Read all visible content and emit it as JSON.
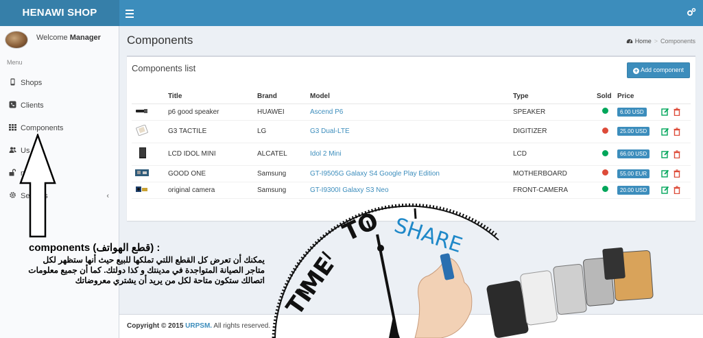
{
  "app": {
    "brand": "HENAWI SHOP"
  },
  "user": {
    "welcome": "Welcome",
    "name": "Manager"
  },
  "sidebar": {
    "menu_header": "Menu",
    "items": [
      {
        "label": "Shops",
        "icon": "mobile-icon"
      },
      {
        "label": "Clients",
        "icon": "phone-square-icon"
      },
      {
        "label": "Components",
        "icon": "grid-icon"
      },
      {
        "label": "Us",
        "icon": "users-icon"
      },
      {
        "label": "nlocking",
        "icon": "unlock-icon"
      },
      {
        "label": "Settings",
        "icon": "gear-icon"
      }
    ]
  },
  "page": {
    "title": "Components",
    "breadcrumb": {
      "home": "Home",
      "current": "Components"
    }
  },
  "box": {
    "title": "Components list",
    "add_button": "Add component",
    "columns": {
      "title": "Title",
      "brand": "Brand",
      "model": "Model",
      "type": "Type",
      "sold": "Sold",
      "price": "Price"
    },
    "rows": [
      {
        "title": "p6 good speaker",
        "brand": "HUAWEI",
        "model": "Ascend P6",
        "type": "SPEAKER",
        "sold": "green",
        "price": "6.00 USD"
      },
      {
        "title": "G3 TACTILE",
        "brand": "LG",
        "model": "G3 Dual-LTE",
        "type": "DIGITIZER",
        "sold": "red",
        "price": "25.00 USD"
      },
      {
        "title": "LCD IDOL MINI",
        "brand": "ALCATEL",
        "model": "Idol 2 Mini",
        "type": "LCD",
        "sold": "green",
        "price": "66.00 USD"
      },
      {
        "title": "GOOD ONE",
        "brand": "Samsung",
        "model": "GT-I9505G Galaxy S4 Google Play Edition",
        "type": "MOTHERBOARD",
        "sold": "red",
        "price": "55.00 EUR"
      },
      {
        "title": "original camera",
        "brand": "Samsung",
        "model": "GT-I9300I Galaxy S3 Neo",
        "type": "FRONT-CAMERA",
        "sold": "green",
        "price": "20.00 USD"
      }
    ]
  },
  "annotation": {
    "title": "components  (قطع الهواتف) :",
    "body": "يمكنك أن تعرض كل القطع اللتي تملكها للبيع حيث أنها ستظهر لكل متاجر الصيانة المتواجدة في مدينتك و كذا دولتك. كما أن جميع معلومات اتصالك ستكون متاحة لكل من يريد أن يشتري معروضاتك"
  },
  "artwork": {
    "word1": "TIME",
    "word2": "TO",
    "word3": "SHARE"
  },
  "footer": {
    "copyright": "Copyright © 2015",
    "brand": "URPSM.",
    "rights": "All rights reserved."
  },
  "colors": {
    "primary": "#3c8dbc",
    "logo_bg": "#367fa9",
    "sold_green": "#00a65a",
    "sold_red": "#dd4b39",
    "edit_icon": "#00a65a",
    "delete_icon": "#dd4b39"
  }
}
